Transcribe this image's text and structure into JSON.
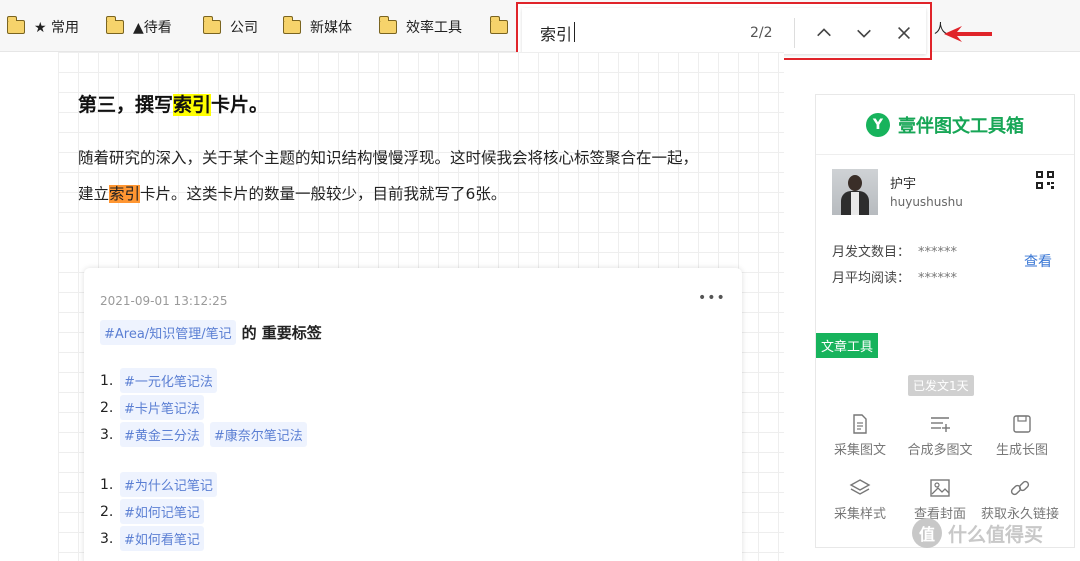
{
  "bookmarks": {
    "items": [
      {
        "label": "★ 常用"
      },
      {
        "label": "▲待看"
      },
      {
        "label": "公司"
      },
      {
        "label": "新媒体"
      },
      {
        "label": "效率工具"
      },
      {
        "label": ""
      }
    ],
    "tail_text": "人"
  },
  "find_bar": {
    "query": "索引",
    "count": "2/2",
    "icons": [
      "chevron-up-icon",
      "chevron-down-icon",
      "close-icon"
    ],
    "highlight_color": "#e0242a"
  },
  "article": {
    "heading_before": "第三，撰写",
    "heading_match": "索引",
    "heading_after": "卡片。",
    "para_line1": "随着研究的深入，关于某个主题的知识结构慢慢浮现。这时候我会将核心标签聚合在一起，",
    "para_line2_before": "建立",
    "para_line2_match": "索引",
    "para_line2_after": "卡片。这类卡片的数量一般较少，目前我就写了6张。",
    "match_colors": {
      "current": "#ffff00",
      "other": "#ff9632"
    }
  },
  "card": {
    "date": "2021-09-01 13:12:25",
    "more": "•••",
    "title_tag": "#Area/知识管理/笔记",
    "title_suffix": "的 重要标签",
    "list1": [
      {
        "num": "1.",
        "tags": [
          "#一元化笔记法"
        ]
      },
      {
        "num": "2.",
        "tags": [
          "#卡片笔记法"
        ]
      },
      {
        "num": "3.",
        "tags": [
          "#黄金三分法",
          "#康奈尔笔记法"
        ]
      }
    ],
    "list2": [
      {
        "num": "1.",
        "tags": [
          "#为什么记笔记"
        ]
      },
      {
        "num": "2.",
        "tags": [
          "#如何记笔记"
        ]
      },
      {
        "num": "3.",
        "tags": [
          "#如何看笔记"
        ]
      }
    ]
  },
  "sidebar": {
    "logo_letter": "Y",
    "title": "壹伴图文工具箱",
    "brand_color": "#17b35c",
    "user_name": "护宇",
    "user_handle": "huyushushu",
    "stat1_label": "月发文数目：",
    "stat1_value": "******",
    "stat2_label": "月平均阅读：",
    "stat2_value": "******",
    "view_link": "查看",
    "badge": "文章工具",
    "sent_badge": "已发文1天",
    "tools": [
      {
        "label": "采集图文",
        "icon": "document-icon"
      },
      {
        "label": "合成多图文",
        "icon": "list-add-icon"
      },
      {
        "label": "生成长图",
        "icon": "save-icon"
      },
      {
        "label": "采集样式",
        "icon": "layers-icon"
      },
      {
        "label": "查看封面",
        "icon": "image-icon"
      },
      {
        "label": "获取永久链接",
        "icon": "link-icon"
      }
    ]
  },
  "watermark": {
    "symbol": "值",
    "text": "什么值得买"
  }
}
